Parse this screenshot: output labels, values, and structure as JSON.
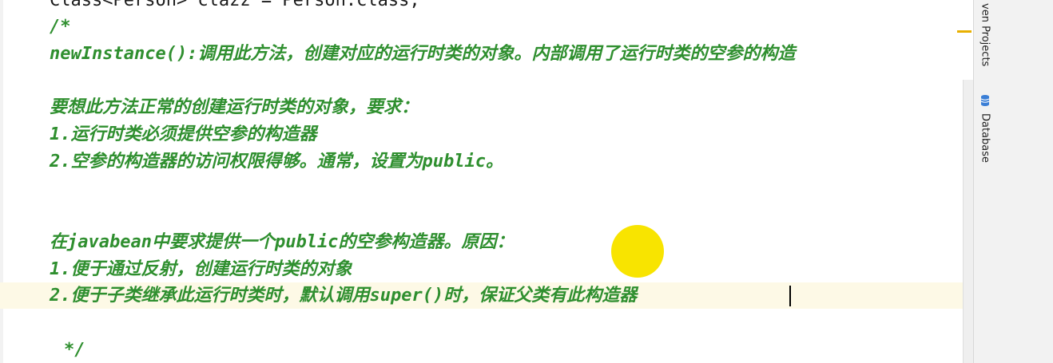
{
  "editor": {
    "lines": [
      {
        "id": "l0",
        "text": "Class<Person> clazz = Person.class;"
      },
      {
        "id": "l1",
        "text": "/*"
      },
      {
        "id": "l2",
        "text": "newInstance():调用此方法，创建对应的运行时类的对象。内部调用了运行时类的空参的构造"
      },
      {
        "id": "l3",
        "text": "要想此方法正常的创建运行时类的对象，要求："
      },
      {
        "id": "l4",
        "text": "1.运行时类必须提供空参的构造器"
      },
      {
        "id": "l5",
        "text": "2.空参的构造器的访问权限得够。通常，设置为public。"
      },
      {
        "id": "l6",
        "text": "在javabean中要求提供一个public的空参构造器。原因："
      },
      {
        "id": "l7",
        "text": "1.便于通过反射，创建运行时类的对象"
      },
      {
        "id": "l8",
        "text": "2.便于子类继承此运行时类时，默认调用super()时，保证父类有此构造器"
      },
      {
        "id": "l9",
        "text": "*/"
      }
    ]
  },
  "side_tabs": {
    "maven": "ven Projects",
    "database": "Database"
  },
  "colors": {
    "comment": "#2f8f2f",
    "current_line": "#fdf9e6",
    "cursor_highlight": "#f8e400"
  },
  "icons": {
    "database": "database-icon"
  }
}
